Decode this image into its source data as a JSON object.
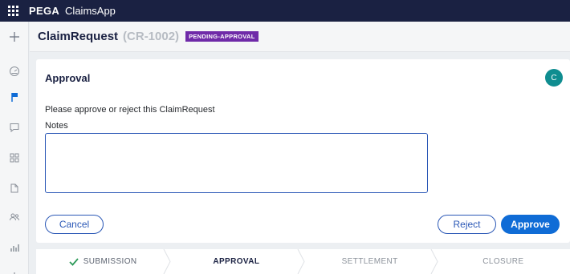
{
  "topbar": {
    "brand": "PEGA",
    "app_name": "ClaimsApp"
  },
  "sidebar": {
    "items": [
      {
        "icon": "plus-icon"
      },
      {
        "icon": "dashboard-icon"
      },
      {
        "icon": "flag-icon",
        "active": true
      },
      {
        "icon": "chat-icon"
      },
      {
        "icon": "grid-icon"
      },
      {
        "icon": "document-icon"
      },
      {
        "icon": "users-icon"
      },
      {
        "icon": "reports-icon"
      }
    ]
  },
  "header": {
    "title": "ClaimRequest",
    "case_id": "(CR-1002)",
    "status": "PENDING-APPROVAL"
  },
  "card": {
    "title": "Approval",
    "avatar_initial": "C",
    "instructions": "Please approve or reject this ClaimRequest",
    "notes_label": "Notes",
    "notes_value": "",
    "cancel_label": "Cancel",
    "reject_label": "Reject",
    "approve_label": "Approve"
  },
  "stages": [
    {
      "label": "SUBMISSION",
      "state": "complete"
    },
    {
      "label": "APPROVAL",
      "state": "current"
    },
    {
      "label": "SETTLEMENT",
      "state": "future"
    },
    {
      "label": "CLOSURE",
      "state": "future"
    }
  ],
  "colors": {
    "topbar": "#1a2142",
    "accent": "#0f6cd6",
    "status_badge": "#6f2aa8",
    "avatar": "#0f8d90",
    "check": "#2e9a5a"
  }
}
